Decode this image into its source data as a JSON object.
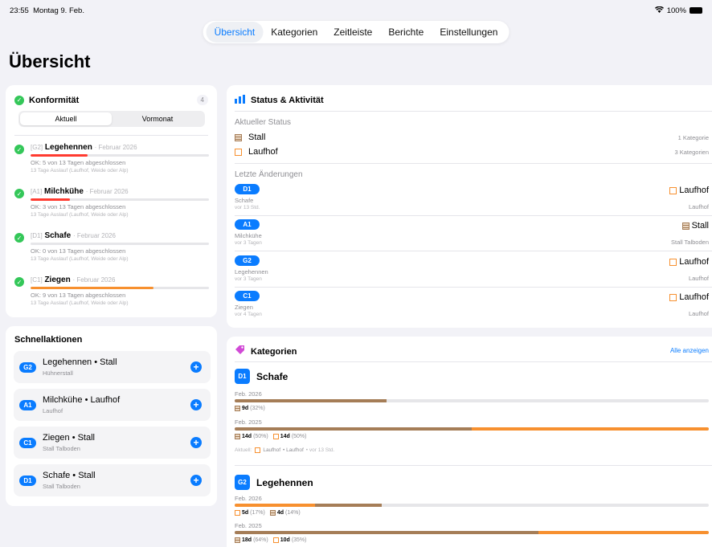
{
  "status_bar": {
    "time": "23:55",
    "date": "Montag 9. Feb.",
    "battery": "100%"
  },
  "tabs": [
    {
      "label": "Übersicht",
      "active": true
    },
    {
      "label": "Kategorien",
      "active": false
    },
    {
      "label": "Zeitleiste",
      "active": false
    },
    {
      "label": "Berichte",
      "active": false
    },
    {
      "label": "Einstellungen",
      "active": false
    }
  ],
  "page_title": "Übersicht",
  "conformity": {
    "title": "Konformität",
    "count": "4",
    "segments": [
      "Aktuell",
      "Vormonat"
    ],
    "items": [
      {
        "code": "[G2]",
        "name": "Legehennen",
        "period": "· Februar 2026",
        "progress": 0.32,
        "bar_color": "#ff3b30",
        "ok": "OK: 5 von 13 Tagen abgeschlossen",
        "note": "13 Tage Auslauf (Laufhof, Weide oder Alp)"
      },
      {
        "code": "[A1]",
        "name": "Milchkühe",
        "period": "· Februar 2026",
        "progress": 0.22,
        "bar_color": "#ff3b30",
        "ok": "OK: 3 von 13 Tagen abgeschlossen",
        "note": "13 Tage Auslauf (Laufhof, Weide oder Alp)"
      },
      {
        "code": "[D1]",
        "name": "Schafe",
        "period": "· Februar 2026",
        "progress": 0.0,
        "bar_color": "#ff3b30",
        "ok": "OK: 0 von 13 Tagen abgeschlossen",
        "note": "13 Tage Auslauf (Laufhof, Weide oder Alp)"
      },
      {
        "code": "[C1]",
        "name": "Ziegen",
        "period": "· Februar 2026",
        "progress": 0.69,
        "bar_color": "#f7902f",
        "ok": "OK: 9 von 13 Tagen abgeschlossen",
        "note": "13 Tage Auslauf (Laufhof, Weide oder Alp)"
      }
    ]
  },
  "quick_actions": {
    "title": "Schnellaktionen",
    "items": [
      {
        "badge": "G2",
        "title": "Legehennen • Stall",
        "subtitle": "Hühnerstall"
      },
      {
        "badge": "A1",
        "title": "Milchkühe • Laufhof",
        "subtitle": "Laufhof"
      },
      {
        "badge": "C1",
        "title": "Ziegen • Stall",
        "subtitle": "Stall Talboden"
      },
      {
        "badge": "D1",
        "title": "Schafe • Stall",
        "subtitle": "Stall Talboden"
      }
    ]
  },
  "status_activity": {
    "title": "Status & Aktivität",
    "current_label": "Aktueller Status",
    "current": [
      {
        "icon": "stall",
        "name": "Stall",
        "count": "1 Kategorie"
      },
      {
        "icon": "laufhof",
        "name": "Laufhof",
        "count": "3 Kategorien"
      }
    ],
    "changes_label": "Letzte Änderungen",
    "changes": [
      {
        "badge": "D1",
        "name": "Schafe",
        "time": "vor 13 Std.",
        "icon": "laufhof",
        "target": "Laufhof",
        "location": "Laufhof"
      },
      {
        "badge": "A1",
        "name": "Milchkühe",
        "time": "vor 3 Tagen",
        "icon": "stall",
        "target": "Stall",
        "location": "Stall Talboden"
      },
      {
        "badge": "G2",
        "name": "Legehennen",
        "time": "vor 3 Tagen",
        "icon": "laufhof",
        "target": "Laufhof",
        "location": "Laufhof"
      },
      {
        "badge": "C1",
        "name": "Ziegen",
        "time": "vor 4 Tagen",
        "icon": "laufhof",
        "target": "Laufhof",
        "location": "Laufhof"
      }
    ]
  },
  "categories": {
    "title": "Kategorien",
    "show_all": "Alle anzeigen",
    "items": [
      {
        "badge": "D1",
        "name": "Schafe",
        "periods": [
          {
            "label": "Feb. 2026",
            "stall": 0.32,
            "laufhof": 0.0,
            "legend": [
              {
                "icon": "stall",
                "value": "9d",
                "pct": "(32%)"
              }
            ]
          },
          {
            "label": "Feb. 2025",
            "stall": 0.5,
            "laufhof": 0.5,
            "legend": [
              {
                "icon": "stall",
                "value": "14d",
                "pct": "(50%)"
              },
              {
                "icon": "laufhof",
                "value": "14d",
                "pct": "(50%)"
              }
            ]
          }
        ],
        "current": {
          "label": "Aktuell:",
          "target": "Laufhof",
          "location": "• Laufhof",
          "time": "• vor 13 Std."
        }
      },
      {
        "badge": "G2",
        "name": "Legehennen",
        "periods": [
          {
            "label": "Feb. 2026",
            "laufhof": 0.17,
            "stall": 0.14,
            "legend": [
              {
                "icon": "laufhof",
                "value": "5d",
                "pct": "(17%)"
              },
              {
                "icon": "stall",
                "value": "4d",
                "pct": "(14%)"
              }
            ]
          },
          {
            "label": "Feb. 2025",
            "stall": 0.64,
            "laufhof": 0.36,
            "legend": [
              {
                "icon": "stall",
                "value": "18d",
                "pct": "(64%)"
              },
              {
                "icon": "laufhof",
                "value": "10d",
                "pct": "(35%)"
              }
            ]
          }
        ]
      }
    ]
  },
  "colors": {
    "accent": "#0a7cff",
    "stall": "#a57d57",
    "laufhof": "#f7902f",
    "ok": "#34c759",
    "alert": "#ff3b30"
  }
}
